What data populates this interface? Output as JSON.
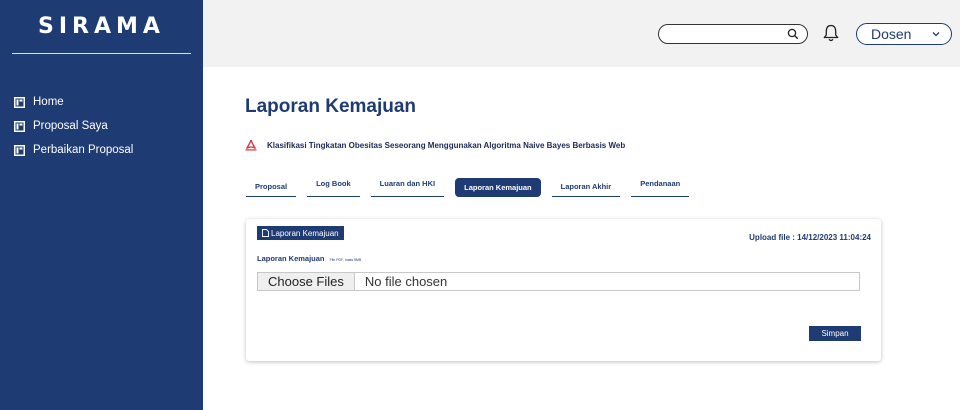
{
  "app": {
    "brand": "SIRAMA"
  },
  "sidebar": {
    "items": [
      {
        "label": "Home",
        "icon": "panel-icon"
      },
      {
        "label": "Proposal Saya",
        "icon": "panel-icon"
      },
      {
        "label": "Perbaikan Proposal",
        "icon": "panel-icon"
      }
    ]
  },
  "header": {
    "search": {
      "placeholder": "",
      "value": ""
    },
    "user_role": "Dosen",
    "icons": [
      "search-icon",
      "bell-icon",
      "chevron-down-icon"
    ]
  },
  "main": {
    "title": "Laporan Kemajuan",
    "proposal_title": "Klasifikasi Tingkatan Obesitas Seseorang Menggunakan Algoritma Naive Bayes Berbasis Web",
    "tabs": [
      {
        "label": "Proposal",
        "active": false
      },
      {
        "label": "Log Book",
        "active": false
      },
      {
        "label": "Luaran dan HKI",
        "active": false
      },
      {
        "label": "Laporan Kemajuan",
        "active": true
      },
      {
        "label": "Laporan Akhir",
        "active": false
      },
      {
        "label": "Pendanaan",
        "active": false
      }
    ],
    "card": {
      "doc_button_label": "Laporan Kemajuan",
      "upload_info": "Upload file : 14/12/2023 11:04:24",
      "field_label": "Laporan Kemajuan",
      "field_hint": "File PDF, maks 5MB",
      "file_button_label": "Choose Files",
      "file_status": "No file chosen",
      "save_label": "Simpan"
    }
  },
  "colors": {
    "primary": "#1f3b73",
    "topbar": "#f2f2f2",
    "pdf_red": "#d9363e"
  }
}
